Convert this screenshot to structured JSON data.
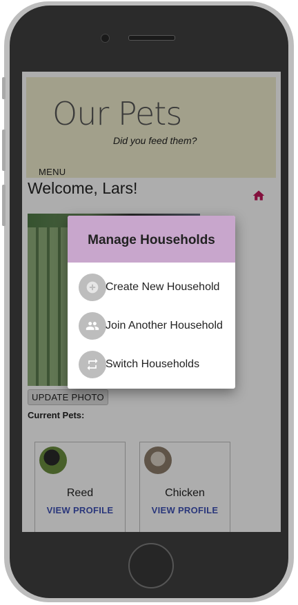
{
  "app": {
    "title": "Our Pets",
    "subtitle": "Did you feed them?",
    "menu_label": "MENU"
  },
  "main": {
    "welcome": "Welcome, Lars!",
    "update_photo_label": "UPDATE PHOTO",
    "current_pets_label": "Current Pets:",
    "pets": [
      {
        "name": "Reed",
        "link_label": "VIEW PROFILE"
      },
      {
        "name": "Chicken",
        "link_label": "VIEW PROFILE"
      }
    ]
  },
  "dialog": {
    "title": "Manage Households",
    "items": [
      {
        "label": "Create New Household",
        "icon": "add-circle-icon"
      },
      {
        "label": "Join Another Household",
        "icon": "group-icon"
      },
      {
        "label": "Switch Households",
        "icon": "swap-icon"
      }
    ]
  },
  "colors": {
    "header_bg": "#efeccd",
    "dialog_header_bg": "#c8a6cc",
    "home_icon": "#c2185b",
    "link_color": "#3f51b5"
  }
}
